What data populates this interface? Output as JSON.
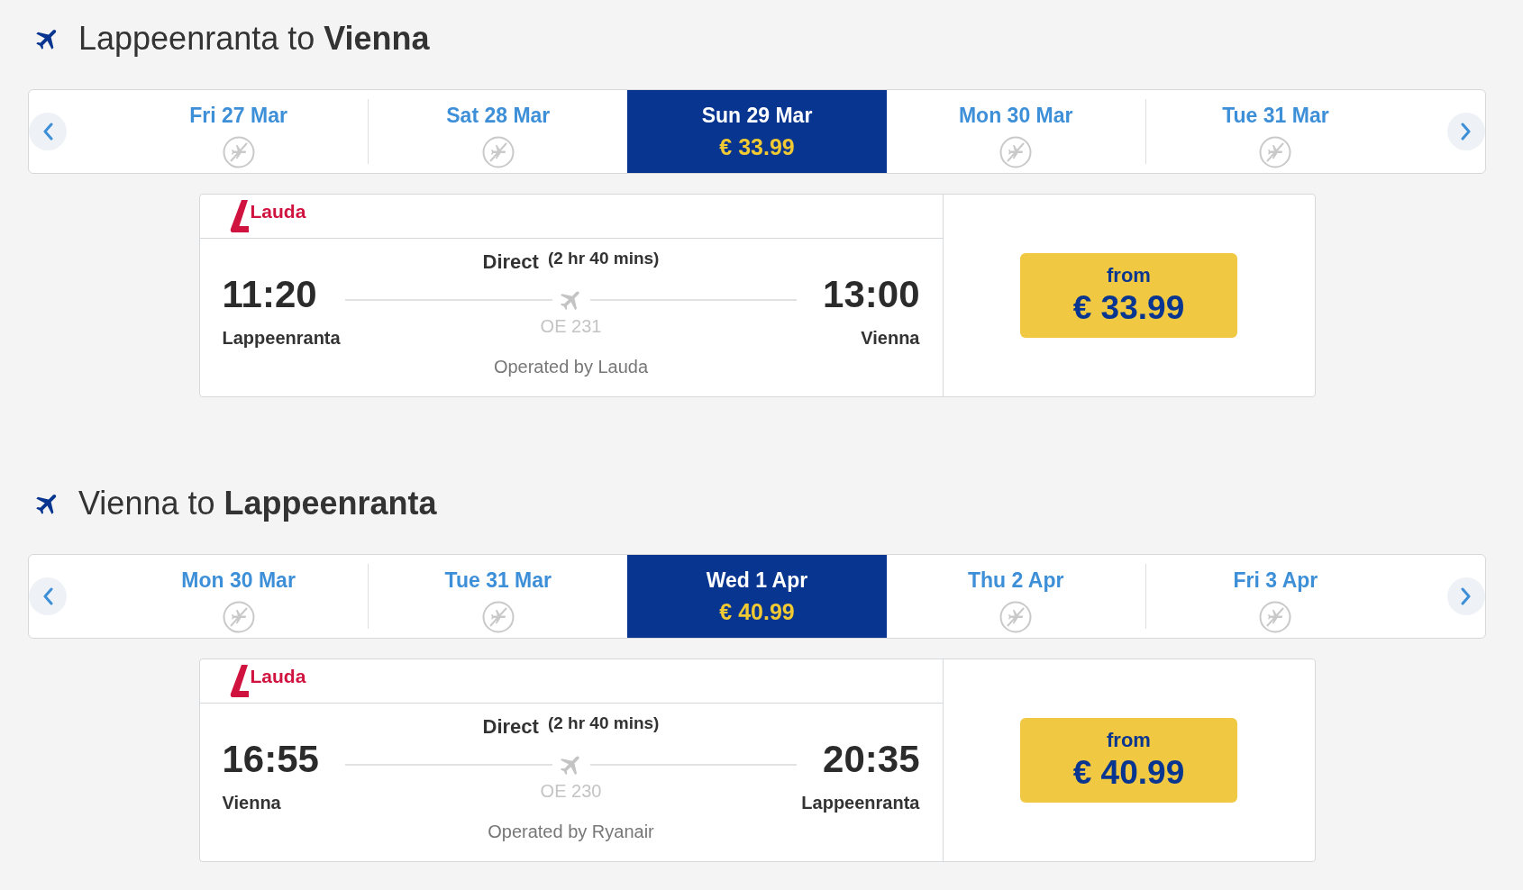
{
  "sections": [
    {
      "heading": "Lappeenranta to **Vienna**",
      "dates": [
        {
          "day": "Fri 27 Mar",
          "selected": false
        },
        {
          "day": "Sat 28 Mar",
          "selected": false
        },
        {
          "day": "Sun 29 Mar",
          "price": "€ 33.99",
          "selected": true
        },
        {
          "day": "Mon 30 Mar",
          "selected": false
        },
        {
          "day": "Tue 31 Mar",
          "selected": false
        }
      ],
      "flight": {
        "airline": "Lauda",
        "departure_time": "11:20",
        "departure_city": "Lappeenranta",
        "stops": "Direct",
        "duration": "(2 hr 40 mins)",
        "flight_number": "OE 231",
        "operated_by": "Operated by Lauda",
        "arrival_time": "13:00",
        "arrival_city": "Vienna",
        "price_label": "from",
        "price": "€ 33.99"
      }
    },
    {
      "heading": "Vienna to **Lappeenranta**",
      "dates": [
        {
          "day": "Mon 30 Mar",
          "selected": false
        },
        {
          "day": "Tue 31 Mar",
          "selected": false
        },
        {
          "day": "Wed 1 Apr",
          "price": "€ 40.99",
          "selected": true
        },
        {
          "day": "Thu 2 Apr",
          "selected": false
        },
        {
          "day": "Fri 3 Apr",
          "selected": false
        }
      ],
      "flight": {
        "airline": "Lauda",
        "departure_time": "16:55",
        "departure_city": "Vienna",
        "stops": "Direct",
        "duration": "(2 hr 40 mins)",
        "flight_number": "OE 230",
        "operated_by": "Operated by Ryanair",
        "arrival_time": "20:35",
        "arrival_city": "Lappeenranta",
        "price_label": "from",
        "price": "€ 40.99"
      }
    }
  ]
}
